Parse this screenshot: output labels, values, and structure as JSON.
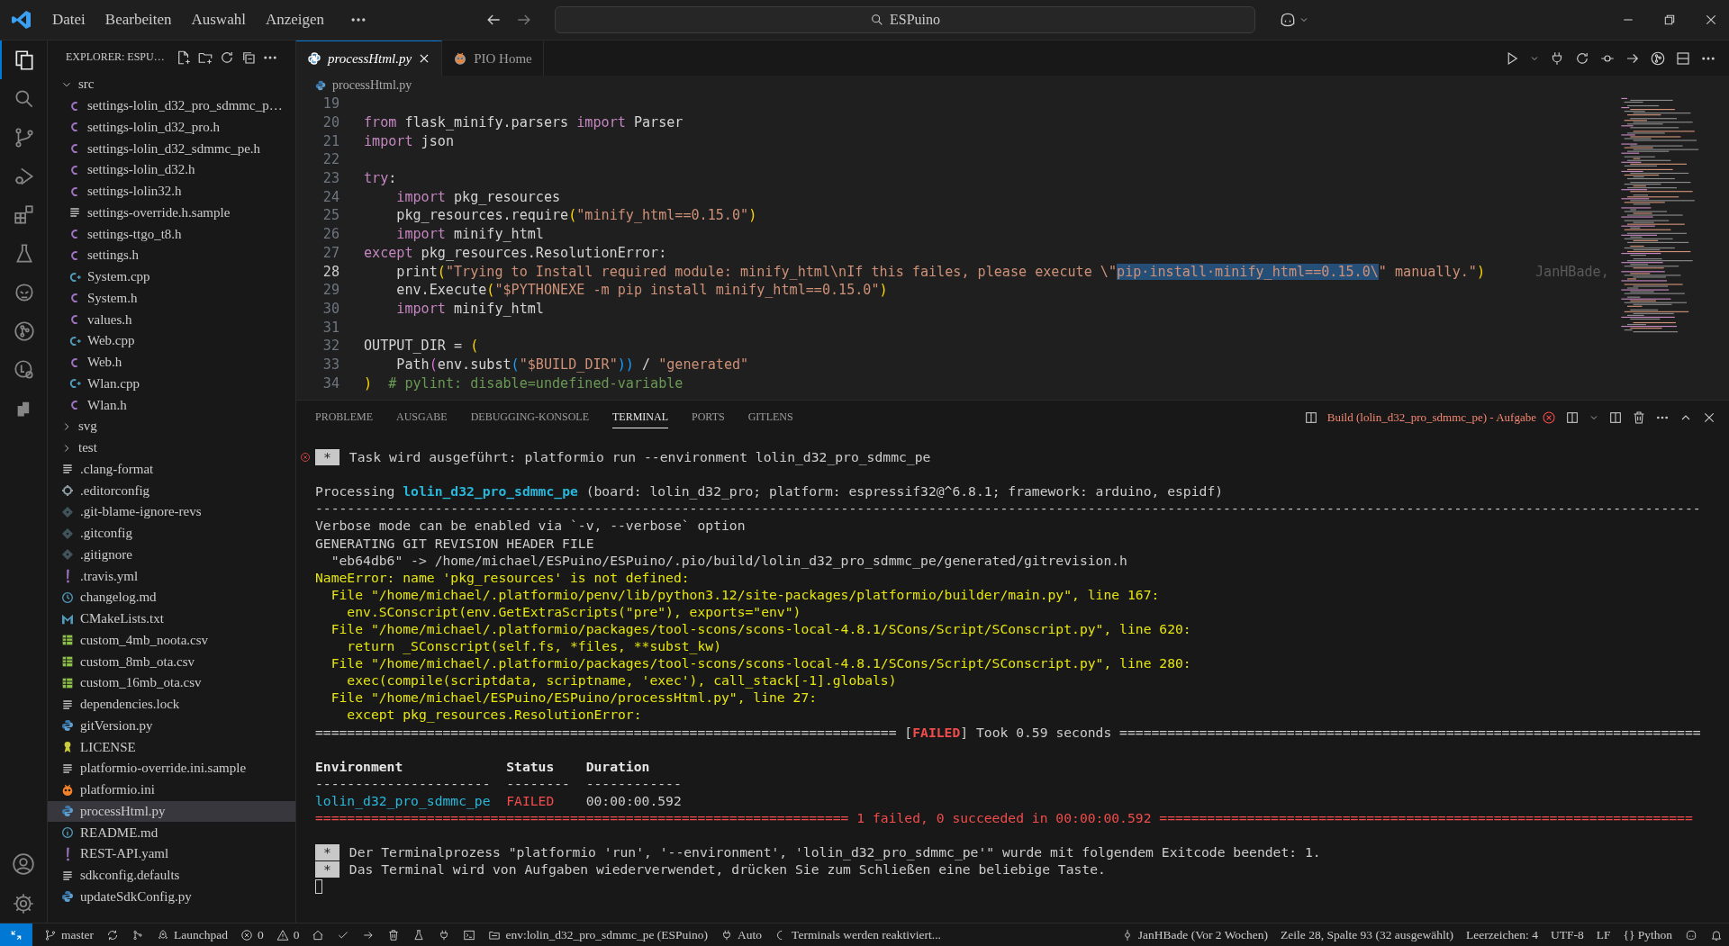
{
  "titlebar": {
    "menu": [
      "Datei",
      "Bearbeiten",
      "Auswahl",
      "Anzeigen"
    ],
    "search": "ESPuino"
  },
  "activity_bar": [
    {
      "kind": "files",
      "selected": true
    },
    {
      "kind": "search",
      "selected": false
    },
    {
      "kind": "scm",
      "selected": false
    },
    {
      "kind": "debug",
      "selected": false
    },
    {
      "kind": "extensions",
      "selected": false
    },
    {
      "kind": "flask",
      "selected": false
    },
    {
      "kind": "alien",
      "selected": false
    },
    {
      "kind": "gitgraph",
      "selected": false
    },
    {
      "kind": "remote",
      "selected": false
    },
    {
      "kind": "blocks",
      "selected": false
    }
  ],
  "explorer": {
    "title": "EXPLORER: ESPU…",
    "tree": [
      {
        "name": "src",
        "kind": "folder",
        "expanded": true,
        "selected": false,
        "children": [
          {
            "name": "settings-lolin_d32_pro_sdmmc_p…",
            "kind": "c",
            "selected": false
          },
          {
            "name": "settings-lolin_d32_pro.h",
            "kind": "c",
            "selected": false
          },
          {
            "name": "settings-lolin_d32_sdmmc_pe.h",
            "kind": "c",
            "selected": false
          },
          {
            "name": "settings-lolin_d32.h",
            "kind": "c",
            "selected": false
          },
          {
            "name": "settings-lolin32.h",
            "kind": "c",
            "selected": false
          },
          {
            "name": "settings-override.h.sample",
            "kind": "lines",
            "selected": false
          },
          {
            "name": "settings-ttgo_t8.h",
            "kind": "c",
            "selected": false
          },
          {
            "name": "settings.h",
            "kind": "c",
            "selected": false
          },
          {
            "name": "System.cpp",
            "kind": "cpp",
            "selected": false
          },
          {
            "name": "System.h",
            "kind": "c",
            "selected": false
          },
          {
            "name": "values.h",
            "kind": "c",
            "selected": false
          },
          {
            "name": "Web.cpp",
            "kind": "cpp",
            "selected": false
          },
          {
            "name": "Web.h",
            "kind": "c",
            "selected": false
          },
          {
            "name": "Wlan.cpp",
            "kind": "cpp",
            "selected": false
          },
          {
            "name": "Wlan.h",
            "kind": "c",
            "selected": false
          }
        ]
      },
      {
        "name": "svg",
        "kind": "folder",
        "expanded": false,
        "selected": false
      },
      {
        "name": "test",
        "kind": "folder",
        "expanded": false,
        "selected": false
      },
      {
        "name": ".clang-format",
        "kind": "lines",
        "selected": false
      },
      {
        "name": ".editorconfig",
        "kind": "gear",
        "selected": false
      },
      {
        "name": ".git-blame-ignore-revs",
        "kind": "git",
        "selected": false
      },
      {
        "name": ".gitconfig",
        "kind": "git",
        "selected": false
      },
      {
        "name": ".gitignore",
        "kind": "git",
        "selected": false
      },
      {
        "name": ".travis.yml",
        "kind": "yaml",
        "selected": false
      },
      {
        "name": "changelog.md",
        "kind": "clock",
        "selected": false
      },
      {
        "name": "CMakeLists.txt",
        "kind": "cmake",
        "selected": false
      },
      {
        "name": "custom_4mb_noota.csv",
        "kind": "csv",
        "selected": false
      },
      {
        "name": "custom_8mb_ota.csv",
        "kind": "csv",
        "selected": false
      },
      {
        "name": "custom_16mb_ota.csv",
        "kind": "csv",
        "selected": false
      },
      {
        "name": "dependencies.lock",
        "kind": "lines",
        "selected": false
      },
      {
        "name": "gitVersion.py",
        "kind": "python",
        "selected": false
      },
      {
        "name": "LICENSE",
        "kind": "license",
        "selected": false
      },
      {
        "name": "platformio-override.ini.sample",
        "kind": "lines",
        "selected": false
      },
      {
        "name": "platformio.ini",
        "kind": "pio",
        "selected": false
      },
      {
        "name": "processHtml.py",
        "kind": "python",
        "selected": true
      },
      {
        "name": "README.md",
        "kind": "info",
        "selected": false
      },
      {
        "name": "REST-API.yaml",
        "kind": "yaml",
        "selected": false
      },
      {
        "name": "sdkconfig.defaults",
        "kind": "lines",
        "selected": false
      },
      {
        "name": "updateSdkConfig.py",
        "kind": "python",
        "selected": false
      }
    ]
  },
  "editor": {
    "tabs": [
      {
        "label": "processHtml.py",
        "kind": "python",
        "selected": true
      },
      {
        "label": "PIO Home",
        "kind": "pio",
        "selected": false
      }
    ],
    "breadcrumb": "processHtml.py",
    "lines": [
      {
        "n": "19",
        "current": false
      },
      {
        "n": "20",
        "current": false,
        "segs": [
          {
            "text": "from",
            "kind": "kw"
          },
          {
            "text": " flask_minify.parsers ",
            "kind": "plain"
          },
          {
            "text": "import",
            "kind": "kw"
          },
          {
            "text": " Parser",
            "kind": "plain"
          }
        ]
      },
      {
        "n": "21",
        "current": false,
        "segs": [
          {
            "text": "import",
            "kind": "kw"
          },
          {
            "text": " json",
            "kind": "plain"
          }
        ]
      },
      {
        "n": "22",
        "current": false
      },
      {
        "n": "23",
        "current": false,
        "segs": [
          {
            "text": "try",
            "kind": "kw"
          },
          {
            "text": ":",
            "kind": "plain"
          }
        ]
      },
      {
        "n": "24",
        "current": false,
        "segs": [
          {
            "text": "    import",
            "kind": "kw"
          },
          {
            "text": " pkg_resources",
            "kind": "plain"
          }
        ]
      },
      {
        "n": "25",
        "current": false,
        "segs": [
          {
            "text": "    pkg_resources.require",
            "kind": "plain"
          },
          {
            "text": "(",
            "kind": "paren"
          },
          {
            "text": "\"minify_html==0.15.0\"",
            "kind": "str"
          },
          {
            "text": ")",
            "kind": "paren"
          }
        ]
      },
      {
        "n": "26",
        "current": false,
        "segs": [
          {
            "text": "    import",
            "kind": "kw"
          },
          {
            "text": " minify_html",
            "kind": "plain"
          }
        ]
      },
      {
        "n": "27",
        "current": false,
        "segs": [
          {
            "text": "except",
            "kind": "kw"
          },
          {
            "text": " pkg_resources.ResolutionError:",
            "kind": "plain"
          }
        ]
      },
      {
        "n": "28",
        "current": true,
        "segs": [
          {
            "text": "    print",
            "kind": "plain"
          },
          {
            "text": "(",
            "kind": "paren"
          },
          {
            "text": "\"Trying to Install required module: minify_html\\nIf this failes, please execute \\\"",
            "kind": "str"
          },
          {
            "text": "pip·install·minify_html==0.15.0\\",
            "kind": "sel"
          },
          {
            "text": "\" manually.\"",
            "kind": "str"
          },
          {
            "text": ")",
            "kind": "paren"
          },
          {
            "text": "JanHBade,",
            "kind": "blame"
          }
        ]
      },
      {
        "n": "29",
        "current": false,
        "segs": [
          {
            "text": "    env.Execute",
            "kind": "plain"
          },
          {
            "text": "(",
            "kind": "paren"
          },
          {
            "text": "\"$PYTHONEXE -m pip install minify_html==0.15.0\"",
            "kind": "str"
          },
          {
            "text": ")",
            "kind": "paren"
          }
        ]
      },
      {
        "n": "30",
        "current": false,
        "segs": [
          {
            "text": "    import",
            "kind": "kw"
          },
          {
            "text": " minify_html",
            "kind": "plain"
          }
        ]
      },
      {
        "n": "31",
        "current": false
      },
      {
        "n": "32",
        "current": false,
        "segs": [
          {
            "text": "OUTPUT_DIR = ",
            "kind": "plain"
          },
          {
            "text": "(",
            "kind": "paren"
          }
        ]
      },
      {
        "n": "33",
        "current": false,
        "segs": [
          {
            "text": "    Path",
            "kind": "plain"
          },
          {
            "text": "(",
            "kind": "paren2"
          },
          {
            "text": "env.subst",
            "kind": "plain"
          },
          {
            "text": "(",
            "kind": "paren3"
          },
          {
            "text": "\"$BUILD_DIR\"",
            "kind": "str"
          },
          {
            "text": "))",
            "kind": "paren3"
          },
          {
            "text": " / ",
            "kind": "plain"
          },
          {
            "text": "\"generated\"",
            "kind": "str"
          }
        ]
      },
      {
        "n": "34",
        "current": false,
        "segs": [
          {
            "text": ")",
            "kind": "paren"
          },
          {
            "text": "  # pylint: disable=undefined-variable",
            "kind": "comment"
          }
        ]
      }
    ]
  },
  "panel": {
    "tabs": [
      {
        "label": "PROBLEME",
        "selected": false
      },
      {
        "label": "AUSGABE",
        "selected": false
      },
      {
        "label": "DEBUGGING-KONSOLE",
        "selected": false
      },
      {
        "label": "TERMINAL",
        "selected": true
      },
      {
        "label": "PORTS",
        "selected": false
      },
      {
        "label": "GITLENS",
        "selected": false
      }
    ],
    "task": "Build (lolin_d32_pro_sdmmc_pe) - Aufgabe",
    "terminal": [
      {
        "kind": "task-error",
        "badge": "*",
        "segs": [
          {
            "text": "Task wird ausgeführt: platformio run --environment lolin_d32_pro_sdmmc_pe",
            "kind": "plain"
          }
        ]
      },
      {
        "kind": "blank"
      },
      {
        "kind": "text",
        "segs": [
          {
            "text": "Processing ",
            "kind": "plain"
          },
          {
            "text": "lolin_d32_pro_sdmmc_pe",
            "kind": "cyan-bold"
          },
          {
            "text": " (board: lolin_d32_pro; platform: espressif32@^6.8.1; framework: arduino, espidf)",
            "kind": "plain"
          }
        ]
      },
      {
        "kind": "text",
        "segs": [
          {
            "text": "------------------------------------------------------------------------------------------------------------------------------------------------------------------------------",
            "kind": "plain"
          }
        ]
      },
      {
        "kind": "text",
        "segs": [
          {
            "text": "Verbose mode can be enabled via `-v, --verbose` option",
            "kind": "plain"
          }
        ]
      },
      {
        "kind": "text",
        "segs": [
          {
            "text": "GENERATING GIT REVISION HEADER FILE",
            "kind": "plain"
          }
        ]
      },
      {
        "kind": "text",
        "segs": [
          {
            "text": "  \"eb64db6\" -> /home/michael/ESPuino/ESPuino/.pio/build/lolin_d32_pro_sdmmc_pe/generated/gitrevision.h",
            "kind": "plain"
          }
        ]
      },
      {
        "kind": "text",
        "segs": [
          {
            "text": "NameError: name 'pkg_resources' is not defined:",
            "kind": "yellow"
          }
        ]
      },
      {
        "kind": "text",
        "segs": [
          {
            "text": "  File \"/home/michael/.platformio/penv/lib/python3.12/site-packages/platformio/builder/main.py\", line 167:",
            "kind": "yellow"
          }
        ]
      },
      {
        "kind": "text",
        "segs": [
          {
            "text": "    env.SConscript(env.GetExtraScripts(\"pre\"), exports=\"env\")",
            "kind": "yellow"
          }
        ]
      },
      {
        "kind": "text",
        "segs": [
          {
            "text": "  File \"/home/michael/.platformio/packages/tool-scons/scons-local-4.8.1/SCons/Script/SConscript.py\", line 620:",
            "kind": "yellow"
          }
        ]
      },
      {
        "kind": "text",
        "segs": [
          {
            "text": "    return _SConscript(self.fs, *files, **subst_kw)",
            "kind": "yellow"
          }
        ]
      },
      {
        "kind": "text",
        "segs": [
          {
            "text": "  File \"/home/michael/.platformio/packages/tool-scons/scons-local-4.8.1/SCons/Script/SConscript.py\", line 280:",
            "kind": "yellow"
          }
        ]
      },
      {
        "kind": "text",
        "segs": [
          {
            "text": "    exec(compile(scriptdata, scriptname, 'exec'), call_stack[-1].globals)",
            "kind": "yellow"
          }
        ]
      },
      {
        "kind": "text",
        "segs": [
          {
            "text": "  File \"/home/michael/ESPuino/ESPuino/processHtml.py\", line 27:",
            "kind": "yellow"
          }
        ]
      },
      {
        "kind": "text",
        "segs": [
          {
            "text": "    except pkg_resources.ResolutionError:",
            "kind": "yellow"
          }
        ]
      },
      {
        "kind": "text",
        "segs": [
          {
            "text": "========================================================================= [",
            "kind": "plain"
          },
          {
            "text": "FAILED",
            "kind": "red-bold"
          },
          {
            "text": "] Took 0.59 seconds =========================================================================",
            "kind": "plain"
          }
        ]
      },
      {
        "kind": "blank"
      },
      {
        "kind": "text",
        "segs": [
          {
            "text": "Environment             Status    Duration",
            "kind": "bold"
          }
        ]
      },
      {
        "kind": "text",
        "segs": [
          {
            "text": "----------------------  --------  ------------",
            "kind": "plain"
          }
        ]
      },
      {
        "kind": "text",
        "segs": [
          {
            "text": "lolin_d32_pro_sdmmc_pe",
            "kind": "cyan"
          },
          {
            "text": "  FAILED",
            "kind": "red"
          },
          {
            "text": "    00:00:00.592",
            "kind": "plain"
          }
        ]
      },
      {
        "kind": "text",
        "segs": [
          {
            "text": "=================================================================== 1 failed, 0 succeeded in 00:00:00.592 ===================================================================",
            "kind": "red"
          }
        ]
      },
      {
        "kind": "blank"
      },
      {
        "kind": "task",
        "badge": "*",
        "segs": [
          {
            "text": "Der Terminalprozess \"platformio 'run', '--environment', 'lolin_d32_pro_sdmmc_pe'\" wurde mit folgendem Exitcode beendet: 1.",
            "kind": "plain"
          }
        ]
      },
      {
        "kind": "task",
        "badge": "*",
        "segs": [
          {
            "text": "Das Terminal wird von Aufgaben wiederverwendet, drücken Sie zum Schließen eine beliebige Taste.",
            "kind": "plain"
          }
        ]
      },
      {
        "kind": "cursor"
      }
    ]
  },
  "status_bar": {
    "left": [
      {
        "kind": "branch",
        "text": "master"
      },
      {
        "kind": "sync"
      },
      {
        "kind": "graph"
      },
      {
        "kind": "rocket",
        "text": "Launchpad"
      },
      {
        "kind": "error",
        "text": "0"
      },
      {
        "kind": "warning",
        "text": "0"
      },
      {
        "kind": "home"
      },
      {
        "kind": "check"
      },
      {
        "kind": "arrow"
      },
      {
        "kind": "trash"
      },
      {
        "kind": "flask"
      },
      {
        "kind": "plug"
      },
      {
        "kind": "terminal"
      },
      {
        "kind": "folder",
        "text": "env:lolin_d32_pro_sdmmc_pe (ESPuino)"
      },
      {
        "kind": "plug",
        "text": "Auto"
      },
      {
        "kind": "spinner",
        "text": "Terminals werden reaktiviert..."
      }
    ],
    "right": [
      {
        "kind": "commit",
        "text": "JanHBade (Vor 2 Wochen)"
      },
      {
        "kind": "none",
        "text": "Zeile 28, Spalte 93 (32 ausgewählt)"
      },
      {
        "kind": "none",
        "text": "Leerzeichen: 4"
      },
      {
        "kind": "none",
        "text": "UTF-8"
      },
      {
        "kind": "none",
        "text": "LF"
      },
      {
        "kind": "none",
        "text": "{} Python"
      },
      {
        "kind": "copilot"
      },
      {
        "kind": "bell"
      }
    ]
  }
}
